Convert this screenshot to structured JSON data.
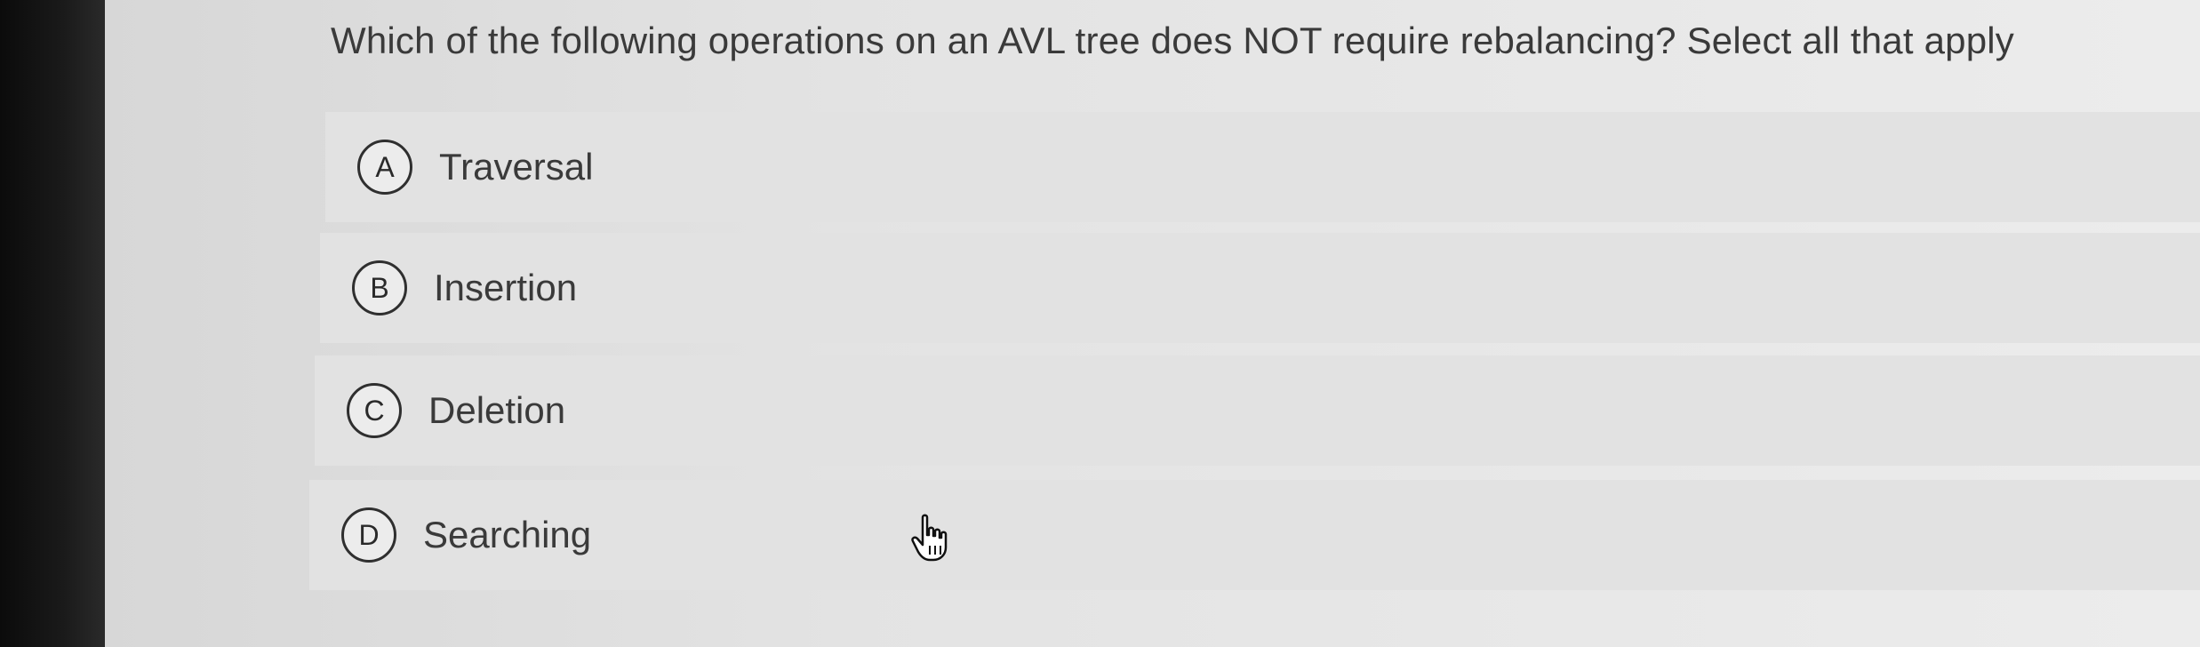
{
  "question": {
    "text": "Which of the following operations on an AVL tree does NOT require rebalancing? Select all that apply"
  },
  "options": [
    {
      "letter": "A",
      "label": "Traversal"
    },
    {
      "letter": "B",
      "label": "Insertion"
    },
    {
      "letter": "C",
      "label": "Deletion"
    },
    {
      "letter": "D",
      "label": "Searching"
    }
  ],
  "cursor": {
    "icon": "hand-pointer-icon"
  }
}
